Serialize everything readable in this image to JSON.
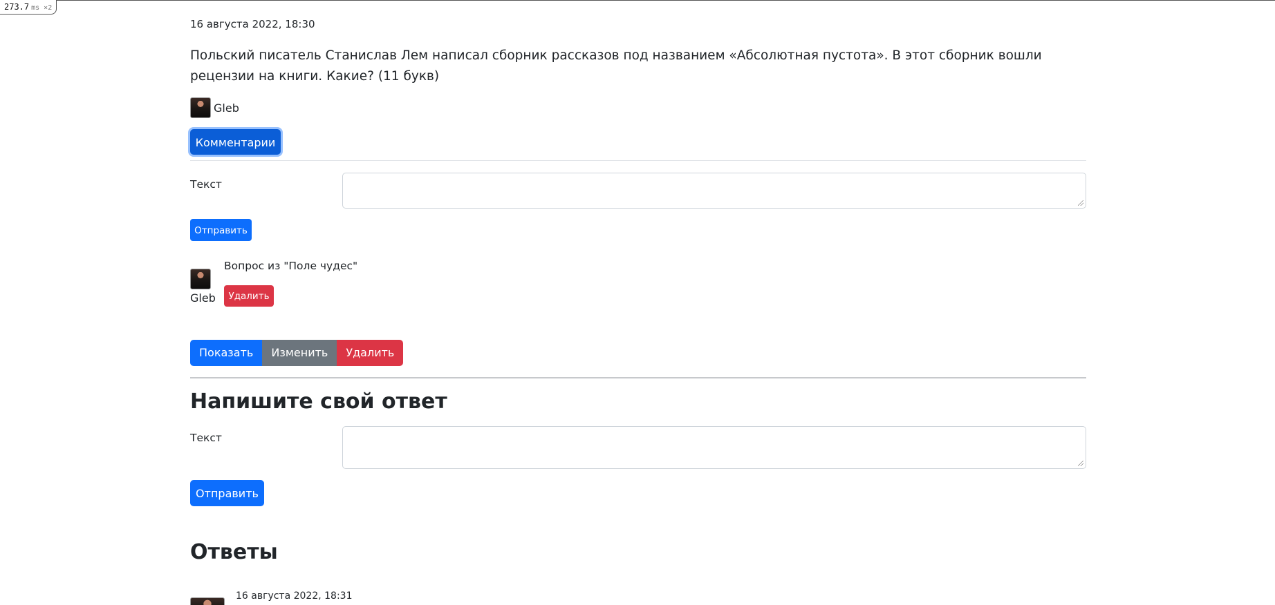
{
  "debug": {
    "timing_value": "273.7",
    "timing_unit": "ms ×2"
  },
  "question": {
    "date": "16 августа 2022, 18:30",
    "text": "Польский писатель Станислав Лем написал сборник рассказов под названием «Абсолютная пустота». В этот сборник вошли рецензии на книги. Какие? (11 букв)",
    "author": "Gleb",
    "comments_button": "Комментарии"
  },
  "comment_form": {
    "label": "Текст",
    "value": "",
    "submit": "Отправить"
  },
  "comments": [
    {
      "author": "Gleb",
      "text": "Вопрос из \"Поле чудес\"",
      "delete_label": "Удалить"
    }
  ],
  "actions": {
    "show": "Показать",
    "edit": "Изменить",
    "delete": "Удалить"
  },
  "answer_form": {
    "heading": "Напишите свой ответ",
    "label": "Текст",
    "value": "",
    "submit": "Отправить"
  },
  "answers": {
    "heading": "Ответы",
    "items": [
      {
        "date": "16 августа 2022, 18:31"
      }
    ]
  },
  "colors": {
    "primary": "#0d6efd",
    "secondary": "#6c757d",
    "danger": "#dc3545"
  }
}
